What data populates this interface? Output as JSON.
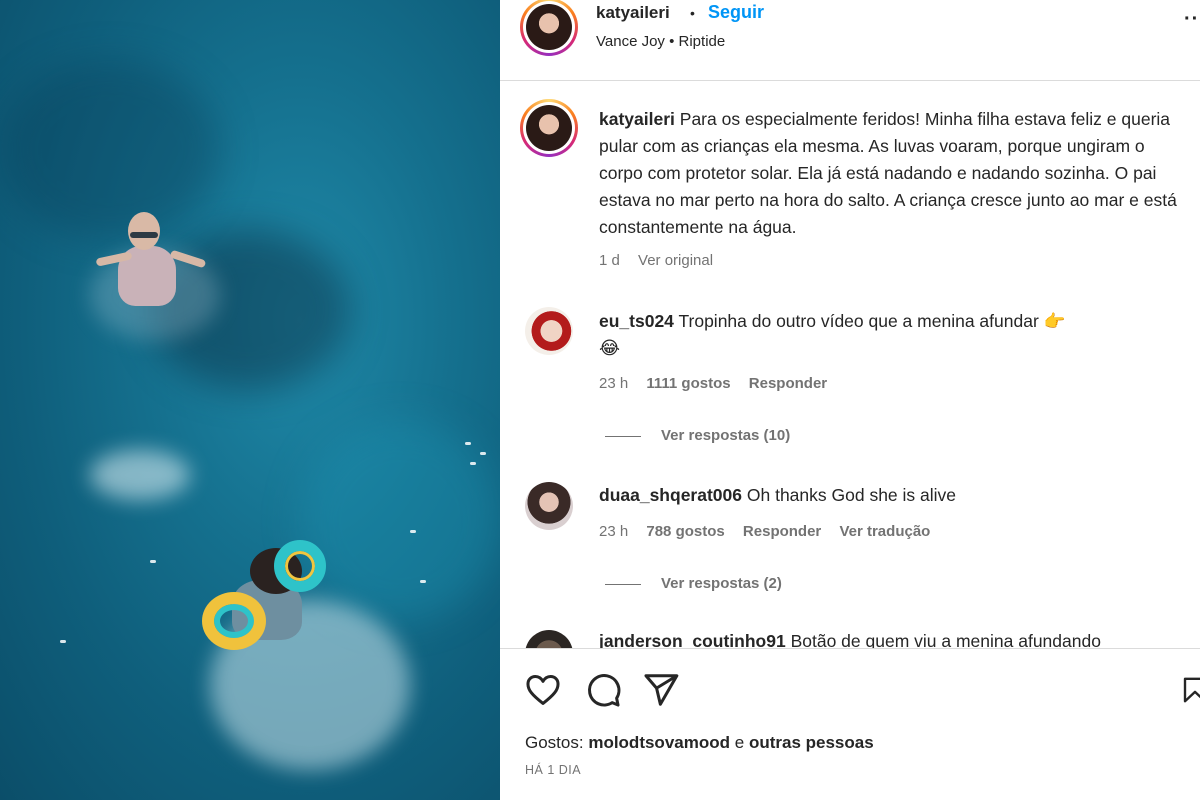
{
  "post": {
    "username": "katyaileri",
    "follow_label": "Seguir",
    "separator": "•",
    "music": "Vance Joy • Riptide",
    "more_label": "···"
  },
  "caption": {
    "username": "katyaileri",
    "text": "Para os especialmente feridos! Minha filha estava feliz e queria pular com as crianças ela mesma. As luvas voaram, porque ungiram o corpo com protetor solar. Ela já está nadando e nadando sozinha. O pai estava no mar perto na hora do salto. A criança cresce junto ao mar e está constantemente na água.",
    "time": "1 d",
    "see_original": "Ver original"
  },
  "comments": [
    {
      "username": "eu_ts024",
      "text": "Tropinha do outro vídeo que a menina afundar 👉",
      "emoji_line": "😂",
      "time": "23 h",
      "likes": "1111 gostos",
      "reply": "Responder",
      "view_replies": "Ver respostas (10)"
    },
    {
      "username": "duaa_shqerat006",
      "text": "Oh thanks God she is alive",
      "time": "23 h",
      "likes": "788 gostos",
      "reply": "Responder",
      "translate": "Ver tradução",
      "view_replies": "Ver respostas (2)"
    },
    {
      "username": "janderson_coutinho91",
      "text": "Botão de quem viu a menina afundando"
    }
  ],
  "footer": {
    "likes_prefix": "Gostos:",
    "likes_user": "molodtsovamood",
    "likes_suffix": "e",
    "likes_others": "outras pessoas",
    "time_ago": "HÁ 1 DIA"
  },
  "icons": {
    "like": "heart-icon",
    "comment": "comment-icon",
    "share": "send-icon",
    "save": "bookmark-icon"
  }
}
